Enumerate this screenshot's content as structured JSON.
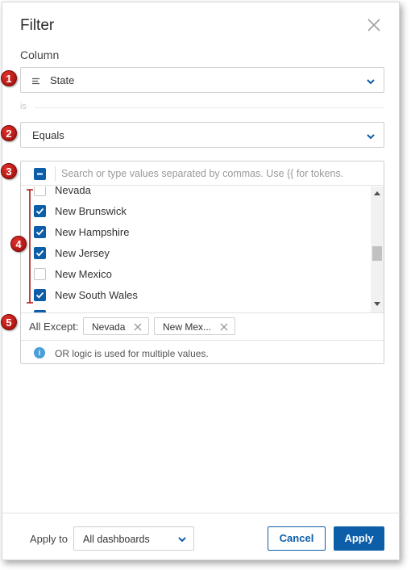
{
  "dialog": {
    "title": "Filter"
  },
  "column": {
    "label": "Column",
    "selected": "State",
    "icon": "lines-icon"
  },
  "is_label": "is",
  "operator": {
    "selected": "Equals"
  },
  "values": {
    "search_placeholder": "Search or type values separated by commas. Use {{ for tokens.",
    "items": [
      {
        "label": "Nevada",
        "checked": false
      },
      {
        "label": "New Brunswick",
        "checked": true
      },
      {
        "label": "New Hampshire",
        "checked": true
      },
      {
        "label": "New Jersey",
        "checked": true
      },
      {
        "label": "New Mexico",
        "checked": false
      },
      {
        "label": "New South Wales",
        "checked": true
      }
    ]
  },
  "except": {
    "label": "All Except:",
    "chips": [
      "Nevada",
      "New Mex..."
    ]
  },
  "info": {
    "text": "OR logic is used for multiple values."
  },
  "footer": {
    "apply_to_label": "Apply to",
    "dashboards_selected": "All dashboards",
    "cancel_label": "Cancel",
    "apply_label": "Apply"
  },
  "markers": [
    "1",
    "2",
    "3",
    "4",
    "5"
  ],
  "colors": {
    "accent": "#0c5ea8",
    "marker": "#c0201b",
    "info": "#4a9fd8"
  }
}
